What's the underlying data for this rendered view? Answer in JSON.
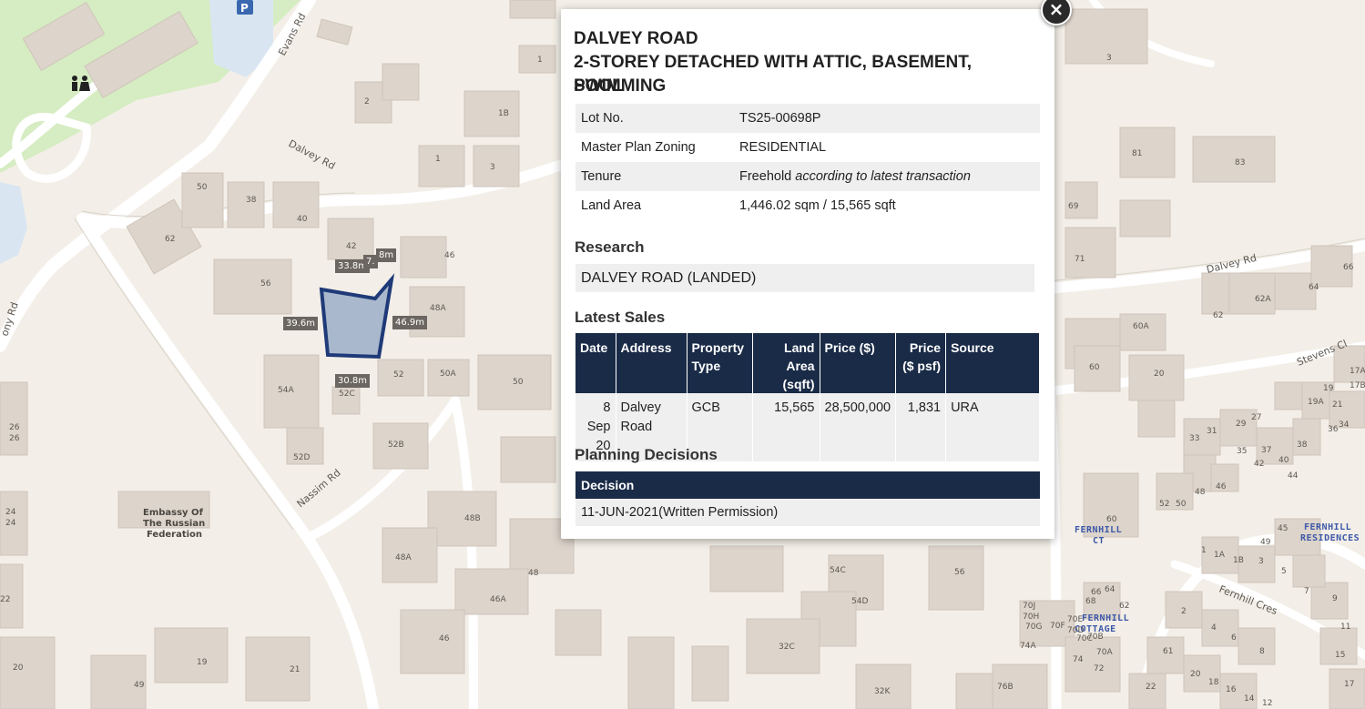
{
  "map": {
    "roads": [
      "Evans Rd",
      "Dalvey Rd",
      "Nassim Rd",
      "ony Rd",
      "Dalvey Rd",
      "Stevens Cl",
      "Fernhill Cres"
    ],
    "places": [
      "Embassy Of",
      "The Russian",
      "Federation",
      "FERNHILL",
      "CT",
      "FERNHILL",
      "COTTAGE",
      "FERNHILL",
      "RESIDENCES"
    ],
    "lot_labels": [
      "1",
      "2",
      "1B",
      "1",
      "3",
      "50",
      "38",
      "40",
      "42",
      "46",
      "62",
      "56",
      "48A",
      "54A",
      "52",
      "50A",
      "50",
      "52C",
      "52D",
      "52B",
      "48B",
      "48A",
      "48",
      "46A",
      "46",
      "19",
      "21",
      "20",
      "49",
      "26",
      "26",
      "24",
      "24",
      "22",
      "81",
      "83",
      "69",
      "71",
      "3",
      "62",
      "62A",
      "64",
      "66",
      "60A",
      "60",
      "20",
      "17A",
      "17B",
      "19",
      "21",
      "19A",
      "36",
      "34",
      "29",
      "27",
      "33",
      "31",
      "35",
      "37",
      "38",
      "42",
      "40",
      "44",
      "46",
      "48",
      "50",
      "52",
      "60",
      "45",
      "49",
      "1",
      "1A",
      "1B",
      "3",
      "5",
      "7",
      "9",
      "11",
      "15",
      "17",
      "2",
      "4",
      "6",
      "8",
      "61",
      "20",
      "18",
      "16",
      "14",
      "12",
      "22",
      "66",
      "64",
      "62",
      "68",
      "70J",
      "70H",
      "70G",
      "70F",
      "70E",
      "70D",
      "70C",
      "70B",
      "70A",
      "74A",
      "74",
      "72",
      "76B",
      "54C",
      "54D",
      "56",
      "32C",
      "32K"
    ],
    "dimensions": [
      "33.8m",
      "7.",
      "8m",
      "39.6m",
      "46.9m",
      "30.8m"
    ]
  },
  "popup": {
    "title_line1": "DALVEY ROAD",
    "title_line2": "2-STOREY DETACHED WITH ATTIC, BASEMENT, SWIMMING",
    "title_line3": "POOL",
    "info": [
      {
        "key": "Lot No.",
        "value": "TS25-00698P"
      },
      {
        "key": "Master Plan Zoning",
        "value": "RESIDENTIAL"
      },
      {
        "key": "Tenure",
        "value": "Freehold",
        "note": "according to latest transaction"
      },
      {
        "key": "Land Area",
        "value": "1,446.02 sqm / 15,565 sqft"
      }
    ],
    "research_heading": "Research",
    "research_item": "DALVEY ROAD (LANDED)",
    "sales_heading": "Latest Sales",
    "sales_columns": [
      "Date",
      "Address",
      "Property Type",
      "Land Area (sqft)",
      "Price ($)",
      "Price ($ psf)",
      "Source"
    ],
    "sales_rows": [
      {
        "date": "8 Sep 20",
        "address": "Dalvey Road",
        "type": "GCB",
        "land_area": "15,565",
        "price": "28,500,000",
        "psf": "1,831",
        "source": "URA"
      }
    ],
    "planning_heading": "Planning Decisions",
    "planning_column": "Decision",
    "planning_rows": [
      "11-JUN-2021(Written Permission)"
    ],
    "close_label": "×"
  },
  "colors": {
    "map_bg": "#f3efe8",
    "building": "#ddd4cb",
    "park": "#d6ecc2",
    "water": "#d9e6f2",
    "table_header": "#1a2b47",
    "selected_lot": "#a9b8cc",
    "selected_lot_outline": "#1f3a78"
  }
}
